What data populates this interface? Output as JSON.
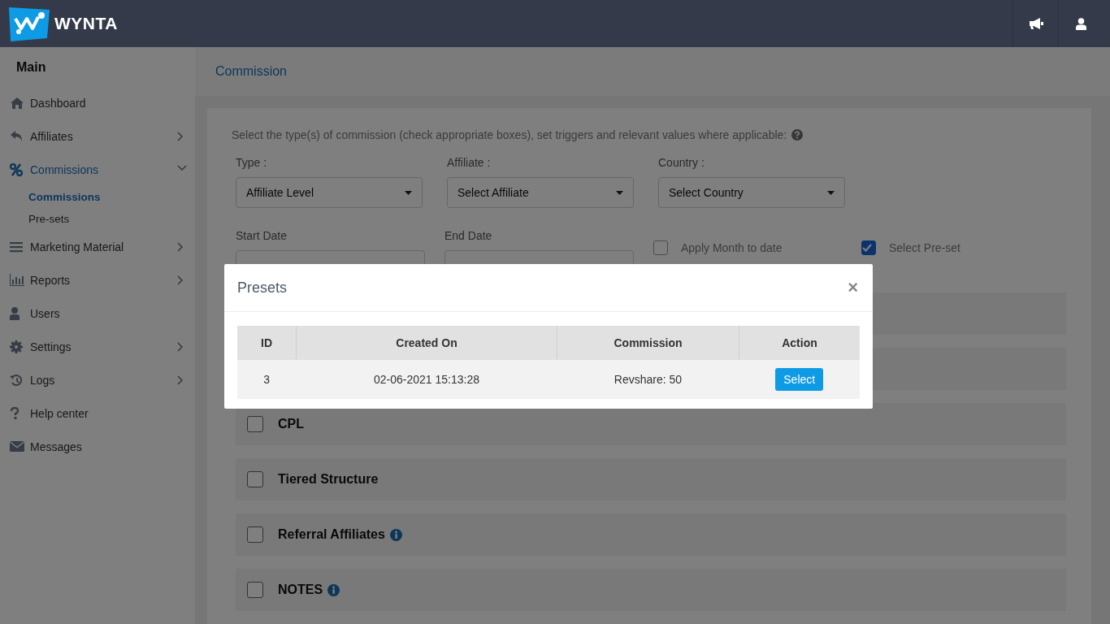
{
  "topbar": {
    "logo_text": "WYNTA"
  },
  "sidebar": {
    "heading": "Main",
    "items": [
      {
        "label": "Dashboard",
        "selected": false
      },
      {
        "label": "Affiliates",
        "selected": false,
        "expanded": false
      },
      {
        "label": "Commissions",
        "selected": true,
        "expanded": true,
        "children": [
          {
            "label": "Commissions",
            "selected": true
          },
          {
            "label": "Pre-sets",
            "selected": false
          }
        ]
      },
      {
        "label": "Marketing Material",
        "selected": false,
        "expanded": false
      },
      {
        "label": "Reports",
        "selected": false,
        "expanded": false
      },
      {
        "label": "Users",
        "selected": false
      },
      {
        "label": "Settings",
        "selected": false,
        "expanded": false
      },
      {
        "label": "Logs",
        "selected": false,
        "expanded": false
      },
      {
        "label": "Help center",
        "selected": false
      },
      {
        "label": "Messages",
        "selected": false
      }
    ]
  },
  "breadcrumb": "Commission",
  "form": {
    "intro": "Select the type(s) of commission (check appropriate boxes), set triggers and relevant values where applicable:",
    "filters": [
      {
        "label": "Type :",
        "value": "Affiliate Level"
      },
      {
        "label": "Affiliate :",
        "value": "Select Affiliate"
      },
      {
        "label": "Country :",
        "value": "Select Country"
      }
    ],
    "dates": [
      {
        "label": "Start Date"
      },
      {
        "label": "End Date"
      }
    ],
    "options": [
      {
        "label": "Apply Month to date",
        "checked": false
      },
      {
        "label": "Select Pre-set",
        "checked": true
      }
    ]
  },
  "sections": [
    {
      "title": "CPL",
      "checked": false,
      "info": false
    },
    {
      "title": "Tiered Structure",
      "checked": false,
      "info": false
    },
    {
      "title": "Referral Affiliates",
      "checked": false,
      "info": true
    },
    {
      "title": "NOTES",
      "checked": false,
      "info": true
    }
  ],
  "modal": {
    "title": "Presets",
    "close": "×",
    "columns": [
      "ID",
      "Created On",
      "Commission",
      "Action"
    ],
    "rows": [
      {
        "cells": [
          "3",
          "02-06-2021 15:13:28",
          "Revshare: 50"
        ],
        "action": "Select"
      }
    ]
  }
}
